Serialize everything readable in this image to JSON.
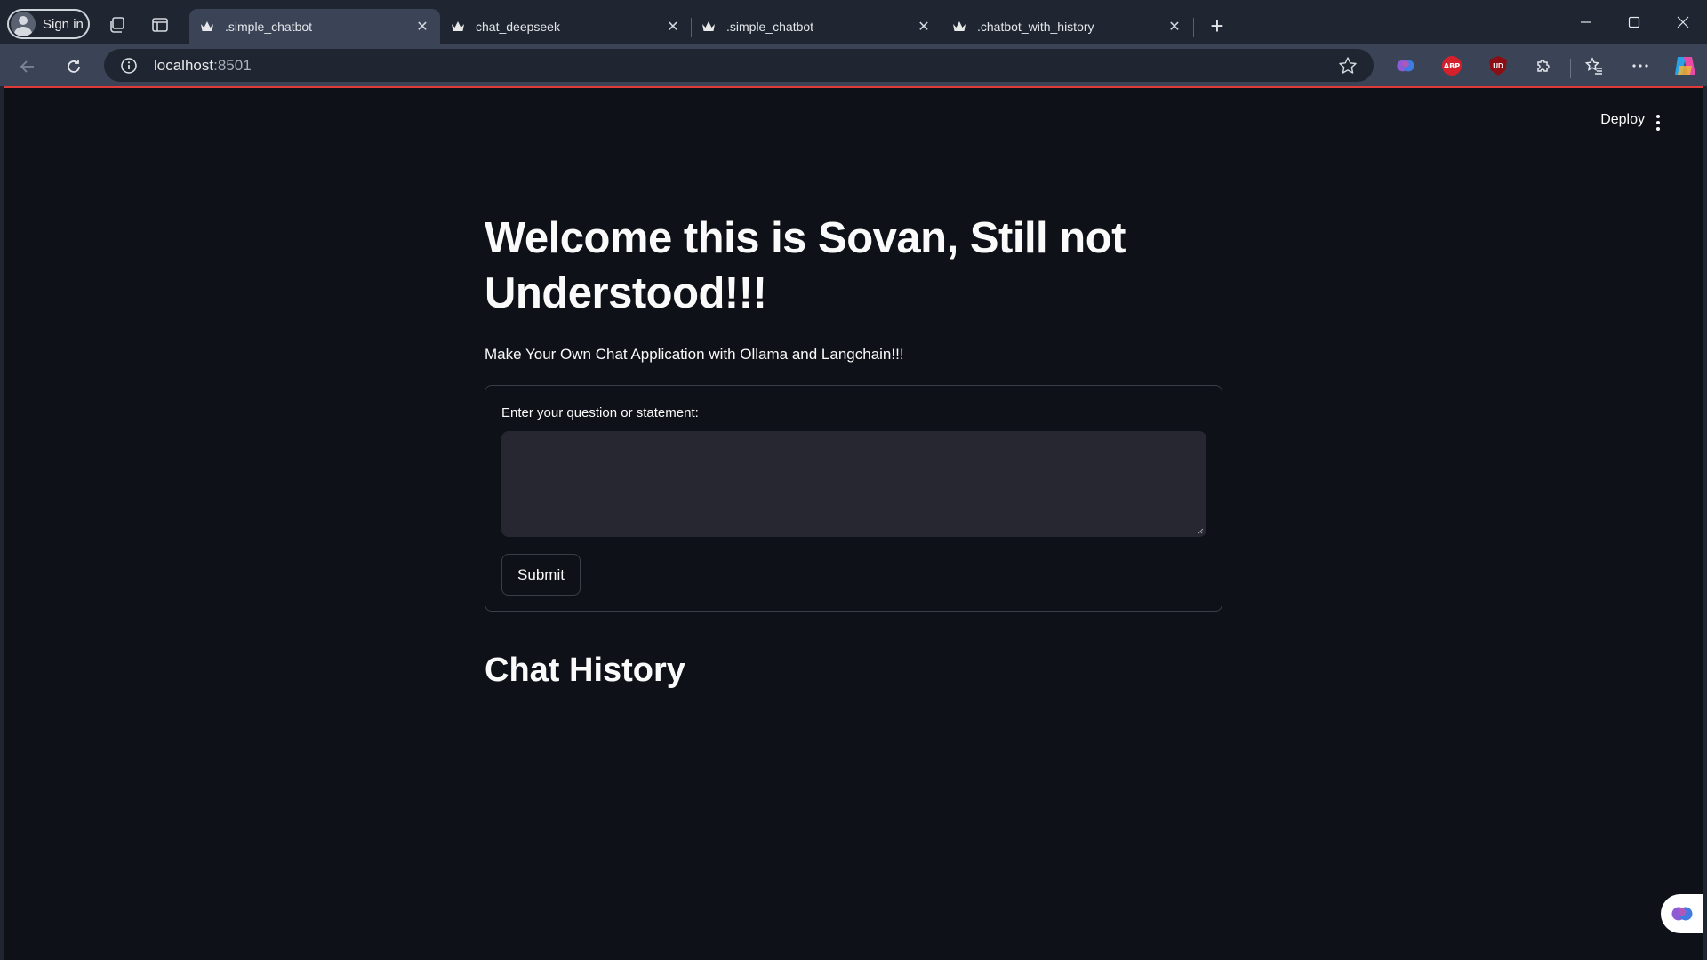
{
  "browser": {
    "signin_label": "Sign in",
    "tabs": [
      {
        "label": ".simple_chatbot",
        "active": true
      },
      {
        "label": "chat_deepseek",
        "active": false
      },
      {
        "label": ".simple_chatbot",
        "active": false
      },
      {
        "label": ".chatbot_with_history",
        "active": false
      }
    ],
    "new_tab_glyph": "+",
    "close_glyph": "✕",
    "url_host": "localhost",
    "url_port": ":8501",
    "extensions": [
      "copilot-brain-icon",
      "adblock-plus-icon",
      "ublock-origin-icon",
      "extensions-puzzle-icon",
      "favorites-icon",
      "more-icon",
      "copilot-icon"
    ],
    "ext_abp_text": "ABP",
    "ext_ub_text": "UD"
  },
  "app": {
    "deploy_label": "Deploy",
    "title": "Welcome this is Sovan, Still not Understood!!!",
    "caption": "Make Your Own Chat Application with Ollama and Langchain!!!",
    "form": {
      "label": "Enter your question or statement:",
      "value": "",
      "submit_label": "Submit"
    },
    "history_title": "Chat History"
  },
  "colors": {
    "chrome_bg": "#1f2631",
    "toolbar_bg": "#3a4456",
    "page_bg": "#0e1117",
    "input_bg": "#262730",
    "text": "#fafafa"
  }
}
